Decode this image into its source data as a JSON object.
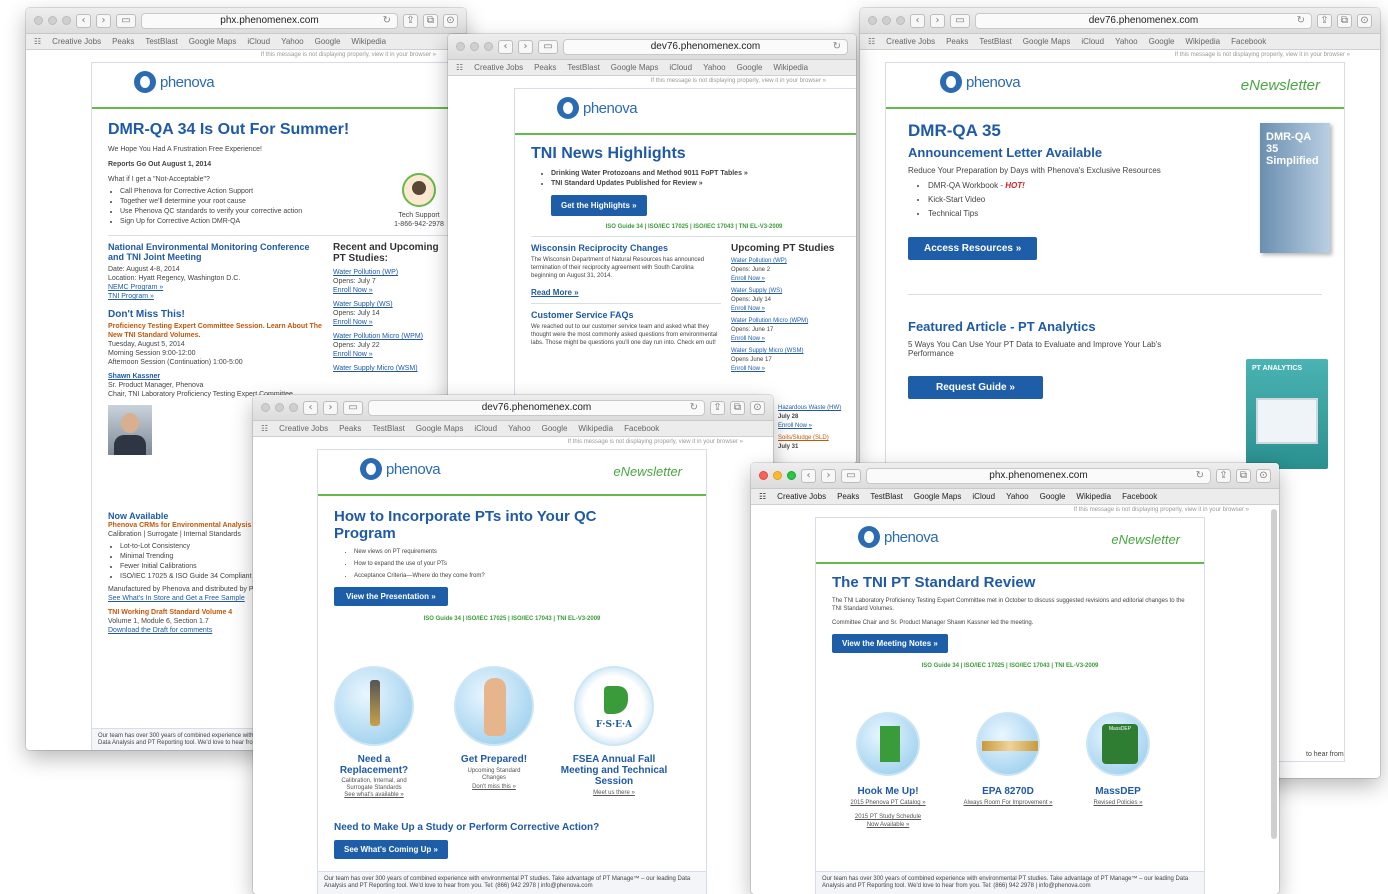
{
  "bookmarks": [
    "Creative Jobs",
    "Peaks",
    "TestBlast",
    "Google Maps",
    "iCloud",
    "Yahoo",
    "Google",
    "Wikipedia",
    "Facebook"
  ],
  "browser_note": "If this message is not displaying properly, view it in your browser »",
  "newsletter_tag": "eNewsletter",
  "brand": "phenova",
  "isos": "ISO Guide 34 | ISO/IEC 17025 | ISO/IEC 17043 | TNI EL-V3-2009",
  "footer_text": "Our team has over 300 years of combined experience with environmental PT studies. Take advantage of PT Manage™ – our leading Data Analysis and PT Reporting tool. We'd love to hear from you. Tel: (866) 942 2978 | info@phenova.com",
  "w1": {
    "url": "phx.phenomenex.com",
    "title": "DMR-QA 34 Is Out For Summer!",
    "subtitle": "We Hope You Had A Frustration Free Experience!",
    "reports": "Reports Go Out August 1, 2014",
    "what_if": "What if I get a \"Not-Acceptable\"?",
    "bullets": [
      "Call Phenova for Corrective Action Support",
      "Together we'll determine your root cause",
      "Use Phenova QC standards to verify your corrective action",
      "Sign Up for Corrective Action DMR-QA"
    ],
    "tech_label": "Tech Support",
    "tech_phone": "1-866-942-2978",
    "conf_title": "National Environmental Monitoring Conference and TNI Joint Meeting",
    "conf_date": "Date: August 4-8, 2014",
    "conf_loc": "Location: Hyatt Regency, Washington D.C.",
    "conf_links": [
      "NEMC Program »",
      "TNI Program »"
    ],
    "miss_title": "Don't Miss This!",
    "miss_orange": "Proficiency Testing Expert Committee Session. Learn About The New TNI Standard Volumes.",
    "miss_lines": [
      "Tuesday, August 5, 2014",
      "Morning Session 9:00-12:00",
      "Afternoon Session (Continuation) 1:00-5:00"
    ],
    "person": "Shawn Kassner",
    "person_role": "Sr. Product Manager, Phenova",
    "person_chair": "Chair, TNI Laboratory Proficiency Testing Expert Committee",
    "studies_title": "Recent and Upcoming PT Studies:",
    "studies": [
      {
        "n": "Water Pollution (WP)",
        "o": "Opens: July 7"
      },
      {
        "n": "Water Supply (WS)",
        "o": "Opens: July 14"
      },
      {
        "n": "Water Pollution Micro (WPM)",
        "o": "Opens: July 22"
      },
      {
        "n": "Water Supply Micro (WSM)",
        "o": ""
      }
    ],
    "enroll": "Enroll Now »",
    "avail_title": "Now Available",
    "avail_orange": "Phenova CRMs for Environmental Analysis",
    "avail_sub": "Calibration | Surrogate | Internal Standards",
    "avail_bullets": [
      "Lot-to-Lot Consistency",
      "Minimal Trending",
      "Fewer Initial Calibrations",
      "ISO/IEC 17025 & ISO Guide 34 Compliant"
    ],
    "manufactured": "Manufactured by Phenova and distributed by Phenomenex",
    "store_link": "See What's In Store and Get a Free Sample",
    "draft_title": "TNI Working Draft Standard Volume 4",
    "draft_vol": "Volume 1, Module 6, Section 1.7",
    "draft_link": "Download the Draft for comments"
  },
  "w2": {
    "url": "dev76.phenomenex.com",
    "title": "TNI News Highlights",
    "bullets": [
      "Drinking Water Protozoans and Method 9011 FoPT Tables »",
      "TNI Standard Updates Published for Review »"
    ],
    "button": "Get the Highlights »",
    "wi_title": "Wisconsin Reciprocity Changes",
    "wi_text": "The Wisconsin Department of Natural Resources has announced termination of their reciprocity agreement with South Carolina beginning on August 31, 2014.",
    "read_more": "Read More »",
    "cs_title": "Customer Service FAQs",
    "cs_text": "We reached out to our customer service team and asked what they thought were the most commonly asked questions from environmental labs. Those might be questions you'll one day run into. Check em out!",
    "studies_title": "Upcoming PT Studies",
    "studies": [
      {
        "n": "Water Pollution (WP)",
        "o": "Opens: June 2"
      },
      {
        "n": "Water Supply (WS)",
        "o": "Opens: July 14"
      },
      {
        "n": "Water Pollution Micro (WPM)",
        "o": "Opens: June 17"
      },
      {
        "n": "Water Supply Micro (WSM)",
        "o": "Opens June 17"
      },
      {
        "n": "Hazardous Waste (HW)",
        "o": "July 28"
      },
      {
        "n": "Soils/Sludge (SLD)",
        "o": "July 31"
      }
    ],
    "enroll": "Enroll Now »"
  },
  "w3": {
    "url": "dev76.phenomenex.com",
    "title": "DMR-QA 35",
    "subtitle": "Announcement Letter Available",
    "lead": "Reduce Your Preparation by Days with Phenova's Exclusive Resources",
    "bullets": [
      "DMR-QA Workbook - ",
      "Kick-Start Video",
      "Technical Tips"
    ],
    "hot": "HOT!",
    "button": "Access Resources »",
    "book_title": "DMR-QA 35 Simplified",
    "feat_title": "Featured Article - PT Analytics",
    "feat_text": "5 Ways You Can Use Your PT Data to Evaluate and Improve Your Lab's Performance",
    "feat_button": "Request Guide »",
    "pt_badge": "PT ANALYTICS",
    "tail": "to hear from"
  },
  "w4": {
    "url": "dev76.phenomenex.com",
    "title": "How to Incorporate PTs into Your QC Program",
    "bullets": [
      "New views on PT requirements",
      "How to expand the use of your PTs",
      "Acceptance Criteria—Where do they come from?"
    ],
    "button": "View the Presentation »",
    "cols": [
      {
        "t": "Need a Replacement?",
        "s": "Calibration, Internal, and Surrogate Standards",
        "l": "See what's available »"
      },
      {
        "t": "Get Prepared!",
        "s": "Upcoming Standard Changes",
        "l": "Don't miss this »"
      },
      {
        "t": "FSEA Annual Fall Meeting and Technical Session",
        "s": "",
        "l": "Meet us there »"
      }
    ],
    "fsea_label": "F·S·E·A",
    "cta_title": "Need to Make Up a Study or Perform Corrective Action?",
    "cta_button": "See What's Coming Up »"
  },
  "w5": {
    "url": "phx.phenomenex.com",
    "title": "The TNI PT Standard Review",
    "text1": "The TNI Laboratory Proficiency Testing Expert Committee met in October to discuss suggested revisions and editorial changes to the TNI Standard Volumes.",
    "text2": "Committee Chair and Sr. Product Manager Shawn Kassner led the meeting.",
    "button": "View the Meeting Notes »",
    "cols": [
      {
        "t": "Hook Me Up!",
        "l": "2015 Phenova PT Catalog »"
      },
      {
        "t": "EPA 8270D",
        "l": "Always Room For Improvement »"
      },
      {
        "t": "MassDEP",
        "l": "Revised Policies »"
      }
    ],
    "extra_link": "2015 PT Study Schedule",
    "extra_link2": "Now Available »",
    "massdep_label": "MassDEP"
  }
}
